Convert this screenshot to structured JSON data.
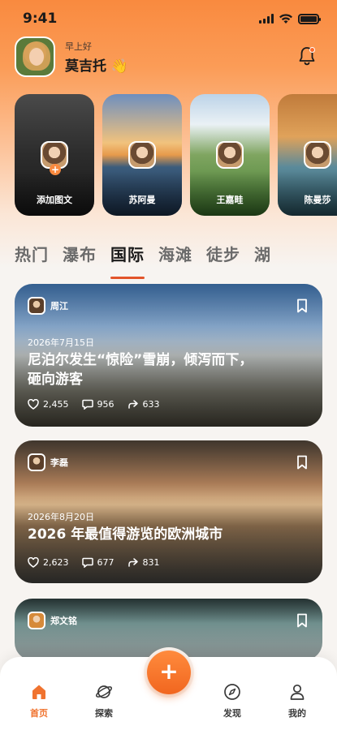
{
  "status": {
    "time": "9:41"
  },
  "header": {
    "greeting": "早上好",
    "user_name": "莫吉托 👋"
  },
  "stories": [
    {
      "label": "添加图文"
    },
    {
      "label": "苏阿曼"
    },
    {
      "label": "王嘉畦"
    },
    {
      "label": "陈曼莎"
    }
  ],
  "tabs": [
    {
      "label": "热门"
    },
    {
      "label": "瀑布"
    },
    {
      "label": "国际"
    },
    {
      "label": "海滩"
    },
    {
      "label": "徒步"
    },
    {
      "label": "湖"
    }
  ],
  "active_tab": "国际",
  "posts": [
    {
      "author": "周江",
      "date": "2026年7月15日",
      "title": "尼泊尔发生“惊险”雪崩，倾泻而下，砸向游客",
      "likes": "2,455",
      "comments": "956",
      "shares": "633"
    },
    {
      "author": "李磊",
      "date": "2026年8月20日",
      "title": "2026 年最值得游览的欧洲城市",
      "likes": "2,623",
      "comments": "677",
      "shares": "831"
    },
    {
      "author": "郑文铭"
    }
  ],
  "nav": {
    "home": "首页",
    "explore": "探索",
    "add": "+",
    "discover": "发现",
    "me": "我的"
  },
  "colors": {
    "accent": "#f0732f",
    "tab_underline": "#e2542a"
  }
}
